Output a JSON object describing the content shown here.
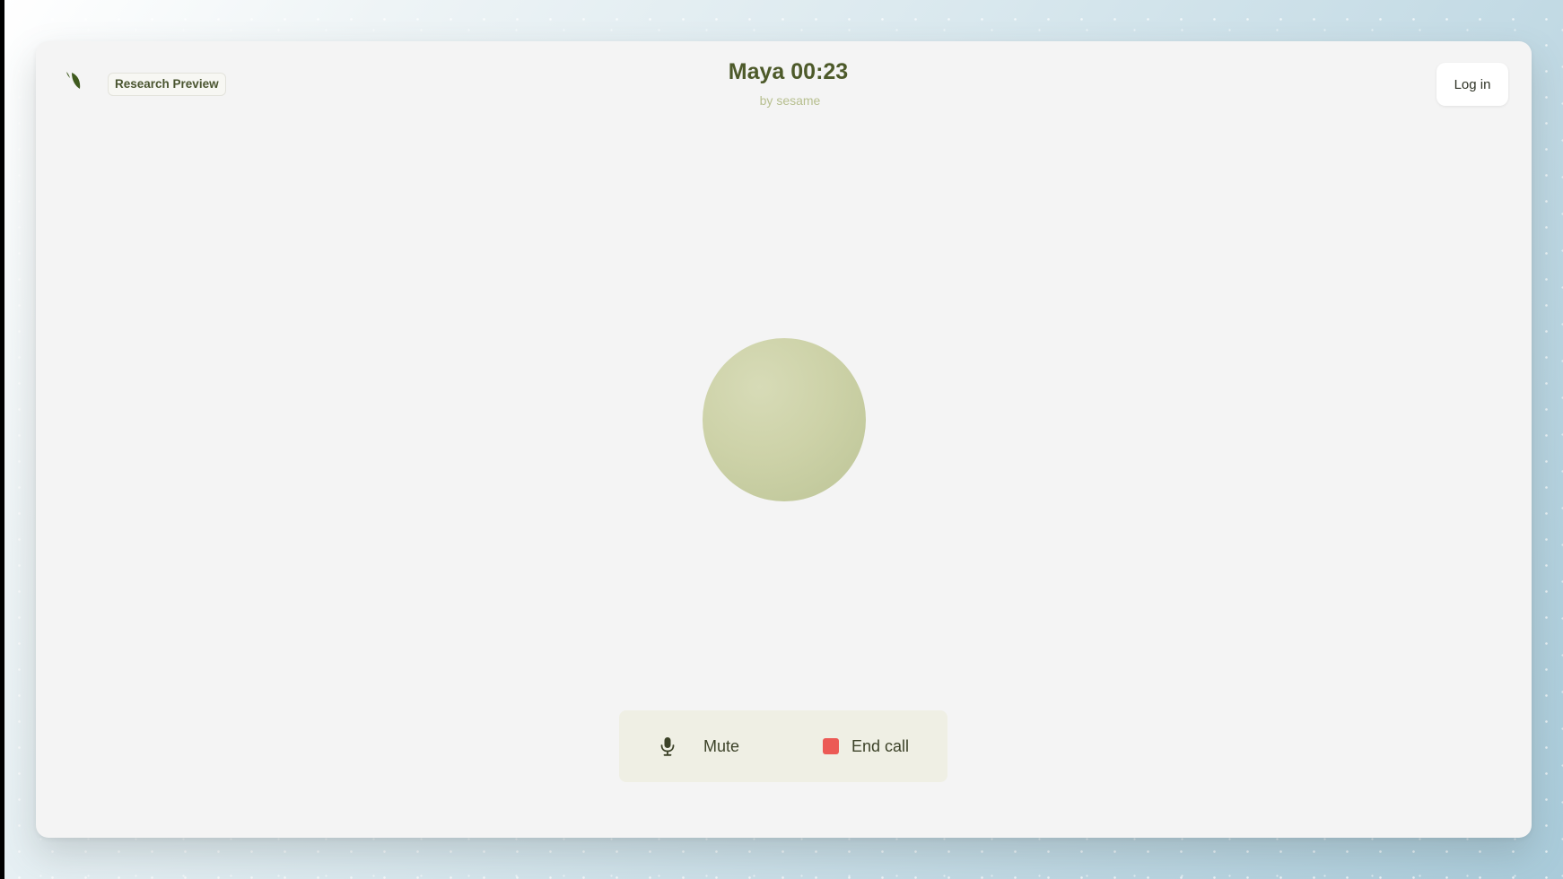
{
  "app": {
    "badge_label": "Research Preview",
    "title": "Maya 00:23",
    "subtitle": "by sesame",
    "login_label": "Log in",
    "logo_icon": "leaf-logo-icon",
    "colors": {
      "accent_text": "#4d5a2a",
      "subtitle_text": "#b7bf8f",
      "orb": "#cdd2a8",
      "end_call": "#ec5a55"
    }
  },
  "controls": {
    "mute_label": "Mute",
    "mute_icon": "microphone-icon",
    "end_label": "End call",
    "end_icon": "stop-square-icon"
  }
}
